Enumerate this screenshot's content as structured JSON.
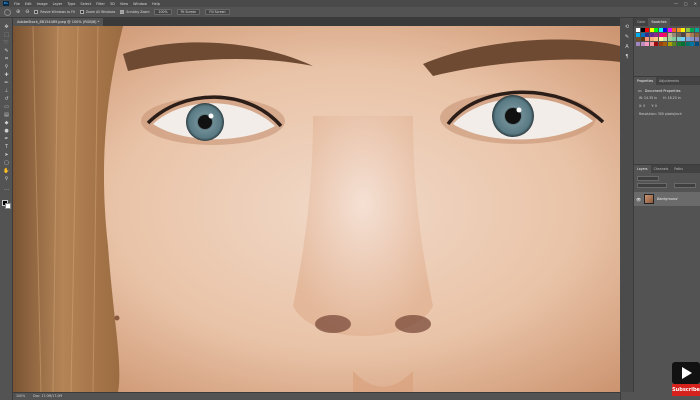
{
  "app": {
    "logo": "Ps"
  },
  "menu": [
    "File",
    "Edit",
    "Image",
    "Layer",
    "Type",
    "Select",
    "Filter",
    "3D",
    "View",
    "Window",
    "Help"
  ],
  "window_controls": [
    "—",
    "▢",
    "✕"
  ],
  "options_bar": {
    "resize_windows_label": "Resize Windows to Fit",
    "zoom_all_label": "Zoom All Windows",
    "scrubby_zoom_label": "Scrubby Zoom",
    "zoom_100_label": "100%",
    "fit_screen_label": "Fit Screen",
    "fill_screen_label": "Fill Screen"
  },
  "document_tab": {
    "title": "AdobeStock_88154489.jpeg @ 100% (RGB/8) *"
  },
  "status_bar": {
    "zoom": "100%",
    "doc_info": "Doc: 17.0M/17.0M"
  },
  "swatches_panel": {
    "tabs": [
      "Color",
      "Swatches"
    ],
    "active_tab": "Swatches",
    "colors": [
      "#ffffff",
      "#000000",
      "#ff0000",
      "#ffff00",
      "#00ff00",
      "#00ffff",
      "#0000ff",
      "#ff00ff",
      "#f26522",
      "#f7941d",
      "#fff200",
      "#8dc63f",
      "#00a651",
      "#00a99d",
      "#00aeef",
      "#0072bc",
      "#2e3192",
      "#662d91",
      "#92278f",
      "#ec008c",
      "#ed145b",
      "#c7b299",
      "#998675",
      "#736357",
      "#534741",
      "#c69c6d",
      "#a67c52",
      "#8c6239",
      "#754c24",
      "#603913",
      "#f69679",
      "#f9ad81",
      "#fdc689",
      "#fff799",
      "#c4df9b",
      "#a3d39c",
      "#82ca9d",
      "#7bcdc8",
      "#6dcff6",
      "#7da7d9",
      "#8393ca",
      "#8781bd",
      "#a187be",
      "#bd8cbf",
      "#f49ac1",
      "#f5989d",
      "#9e0b0f",
      "#a0410d",
      "#a36209",
      "#aba000",
      "#598527",
      "#1a7b30",
      "#007236",
      "#00746b",
      "#0076a3",
      "#004a80"
    ]
  },
  "properties_panel": {
    "tabs": [
      "Properties",
      "Adjustments"
    ],
    "title": "Document Properties",
    "w": "W: 24.35 in",
    "h": "H: 16.25 in",
    "x": "X: 0",
    "y": "Y: 0",
    "resolution": "Resolution: 300 pixels/inch"
  },
  "layers_panel": {
    "tabs": [
      "Layers",
      "Channels",
      "Paths"
    ],
    "layers": [
      {
        "name": "Background"
      }
    ]
  },
  "subscribe": {
    "label": "Subscribe"
  }
}
